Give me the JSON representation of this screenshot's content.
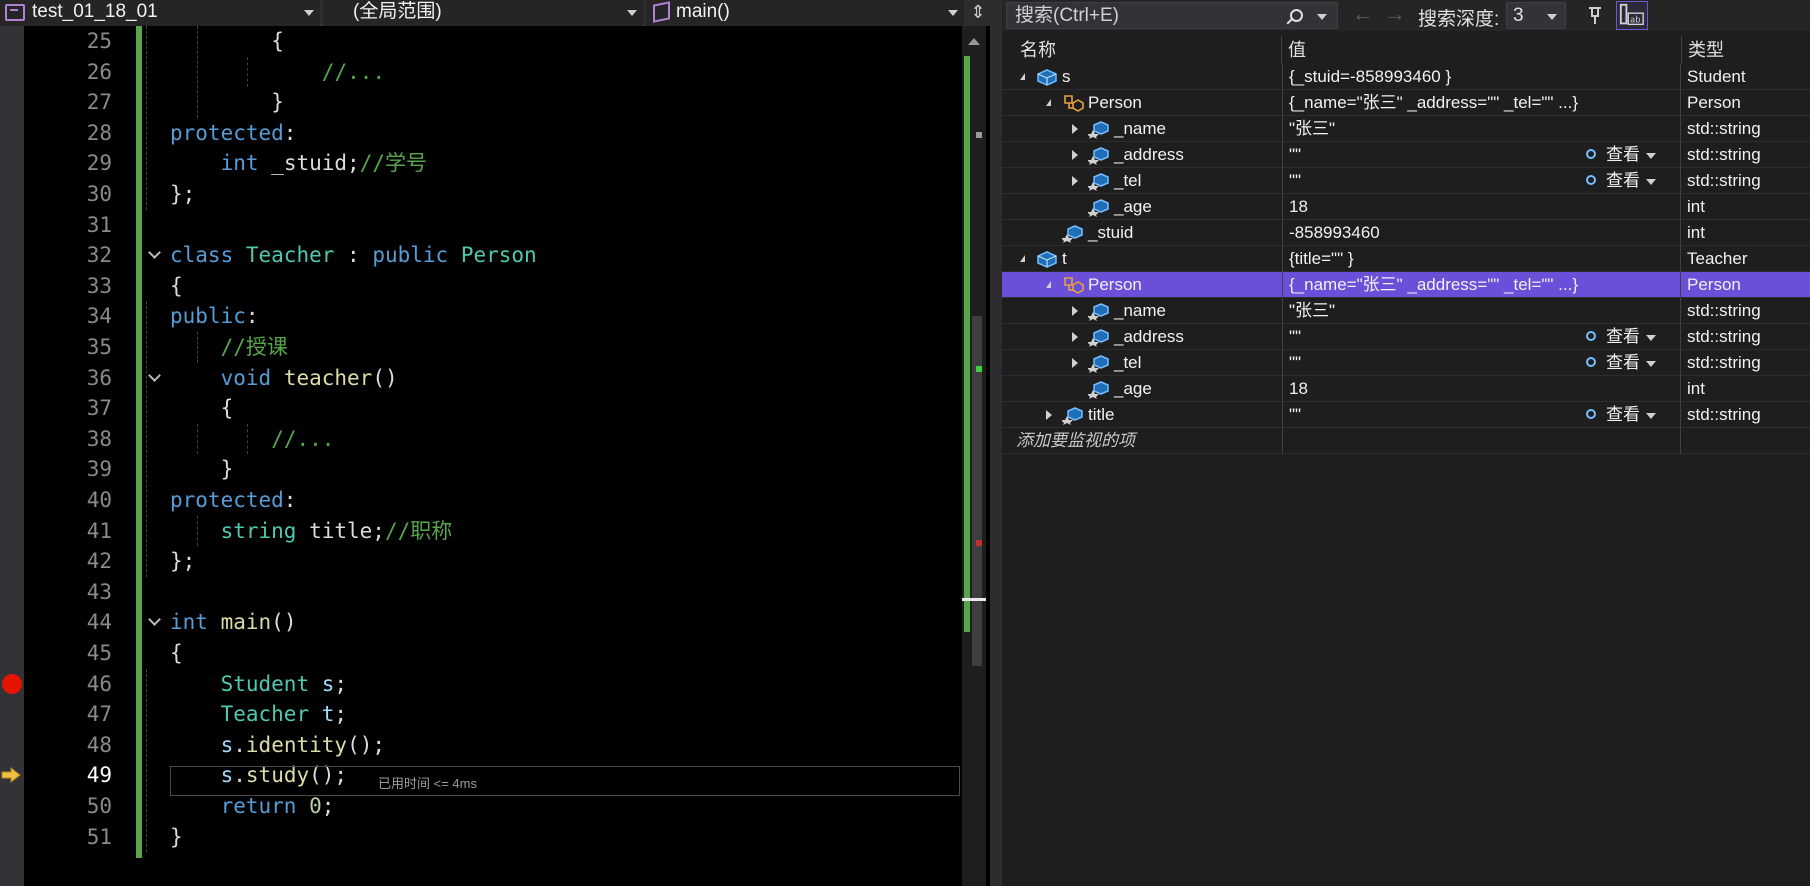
{
  "editor": {
    "nav": {
      "file": "test_01_18_01",
      "scope": "(全局范围)",
      "member": "main()"
    },
    "current_line": 49,
    "elapsed_hint": "已用时间 <= 4ms",
    "lines": [
      {
        "n": "25",
        "indent": 2,
        "tokens": [
          [
            "{",
            "p"
          ]
        ]
      },
      {
        "n": "26",
        "indent": 3,
        "tokens": [
          [
            "//...",
            "cm"
          ]
        ]
      },
      {
        "n": "27",
        "indent": 2,
        "tokens": [
          [
            "}",
            "p"
          ]
        ]
      },
      {
        "n": "28",
        "indent": 0,
        "tokens": [
          [
            "protected",
            "kw"
          ],
          [
            ":",
            "p"
          ]
        ]
      },
      {
        "n": "29",
        "indent": 1,
        "tokens": [
          [
            "int",
            "kw"
          ],
          [
            " _stuid;",
            "p"
          ],
          [
            "//学号",
            "cm"
          ]
        ]
      },
      {
        "n": "30",
        "indent": 0,
        "tokens": [
          [
            "};",
            "p"
          ]
        ]
      },
      {
        "n": "31",
        "indent": 0,
        "tokens": []
      },
      {
        "n": "32",
        "indent": 0,
        "fold": true,
        "tokens": [
          [
            "class",
            "kw"
          ],
          [
            " ",
            "p"
          ],
          [
            "Teacher",
            "ty"
          ],
          [
            " : ",
            "p"
          ],
          [
            "public",
            "kw"
          ],
          [
            " ",
            "p"
          ],
          [
            "Person",
            "ty"
          ]
        ]
      },
      {
        "n": "33",
        "indent": 0,
        "tokens": [
          [
            "{",
            "p"
          ]
        ]
      },
      {
        "n": "34",
        "indent": 0,
        "tokens": [
          [
            "public",
            "kw"
          ],
          [
            ":",
            "p"
          ]
        ]
      },
      {
        "n": "35",
        "indent": 1,
        "tokens": [
          [
            "//授课",
            "cm"
          ]
        ]
      },
      {
        "n": "36",
        "indent": 1,
        "fold": true,
        "tokens": [
          [
            "void",
            "kw"
          ],
          [
            " ",
            "p"
          ],
          [
            "teacher",
            "fn"
          ],
          [
            "()",
            "p"
          ]
        ]
      },
      {
        "n": "37",
        "indent": 1,
        "tokens": [
          [
            "{",
            "p"
          ]
        ]
      },
      {
        "n": "38",
        "indent": 2,
        "tokens": [
          [
            "//...",
            "cm"
          ]
        ]
      },
      {
        "n": "39",
        "indent": 1,
        "tokens": [
          [
            "}",
            "p"
          ]
        ]
      },
      {
        "n": "40",
        "indent": 0,
        "tokens": [
          [
            "protected",
            "kw"
          ],
          [
            ":",
            "p"
          ]
        ]
      },
      {
        "n": "41",
        "indent": 1,
        "tokens": [
          [
            "string",
            "ty"
          ],
          [
            " title;",
            "p"
          ],
          [
            "//职称",
            "cm"
          ]
        ]
      },
      {
        "n": "42",
        "indent": 0,
        "tokens": [
          [
            "};",
            "p"
          ]
        ]
      },
      {
        "n": "43",
        "indent": 0,
        "tokens": []
      },
      {
        "n": "44",
        "indent": 0,
        "fold": true,
        "tokens": [
          [
            "int",
            "kw"
          ],
          [
            " ",
            "p"
          ],
          [
            "main",
            "fn"
          ],
          [
            "()",
            "p"
          ]
        ]
      },
      {
        "n": "45",
        "indent": 0,
        "tokens": [
          [
            "{",
            "p"
          ]
        ]
      },
      {
        "n": "46",
        "indent": 1,
        "tokens": [
          [
            "Student",
            "ty"
          ],
          [
            " ",
            "p"
          ],
          [
            "s",
            "id"
          ],
          [
            ";",
            "p"
          ]
        ]
      },
      {
        "n": "47",
        "indent": 1,
        "tokens": [
          [
            "Teacher",
            "ty"
          ],
          [
            " ",
            "p"
          ],
          [
            "t",
            "id"
          ],
          [
            ";",
            "p"
          ]
        ]
      },
      {
        "n": "48",
        "indent": 1,
        "tokens": [
          [
            "s",
            "id"
          ],
          [
            ".",
            "p"
          ],
          [
            "identity",
            "fn"
          ],
          [
            "();",
            "p"
          ]
        ]
      },
      {
        "n": "49",
        "indent": 1,
        "tokens": [
          [
            "s",
            "id"
          ],
          [
            ".",
            "p"
          ],
          [
            "study",
            "fn"
          ],
          [
            "();",
            "p"
          ]
        ]
      },
      {
        "n": "50",
        "indent": 1,
        "tokens": [
          [
            "return",
            "kw"
          ],
          [
            " ",
            "p"
          ],
          [
            "0",
            "num"
          ],
          [
            ";",
            "p"
          ]
        ]
      },
      {
        "n": "51",
        "indent": 0,
        "tokens": [
          [
            "}",
            "p"
          ]
        ]
      }
    ]
  },
  "watch": {
    "search_placeholder": "搜索(Ctrl+E)",
    "depth_label": "搜索深度:",
    "depth_value": "3",
    "columns": {
      "name": "名称",
      "value": "值",
      "type": "类型"
    },
    "view_label": "查看",
    "add_item": "添加要监视的项",
    "rows": [
      {
        "level": 0,
        "exp": "open",
        "icon": "var",
        "name": "s",
        "value": "{_stuid=-858993460 }",
        "type": "Student"
      },
      {
        "level": 1,
        "exp": "open",
        "icon": "base",
        "name": "Person",
        "value": "{_name=\"张三\" _address=\"\" _tel=\"\" ...}",
        "type": "Person"
      },
      {
        "level": 2,
        "exp": "closed",
        "icon": "field",
        "name": "_name",
        "value": "\"张三\"",
        "type": "std::string"
      },
      {
        "level": 2,
        "exp": "closed",
        "icon": "field",
        "name": "_address",
        "value": "\"\"",
        "type": "std::string",
        "view": true
      },
      {
        "level": 2,
        "exp": "closed",
        "icon": "field",
        "name": "_tel",
        "value": "\"\"",
        "type": "std::string",
        "view": true
      },
      {
        "level": 2,
        "exp": "none",
        "icon": "field",
        "name": "_age",
        "value": "18",
        "type": "int"
      },
      {
        "level": 1,
        "exp": "none",
        "icon": "field",
        "name": "_stuid",
        "value": "-858993460",
        "type": "int"
      },
      {
        "level": 0,
        "exp": "open",
        "icon": "var",
        "name": "t",
        "value": "{title=\"\" }",
        "type": "Teacher"
      },
      {
        "level": 1,
        "exp": "open",
        "icon": "base",
        "name": "Person",
        "value": "{_name=\"张三\" _address=\"\" _tel=\"\" ...}",
        "type": "Person",
        "selected": true
      },
      {
        "level": 2,
        "exp": "closed",
        "icon": "field",
        "name": "_name",
        "value": "\"张三\"",
        "type": "std::string"
      },
      {
        "level": 2,
        "exp": "closed",
        "icon": "field",
        "name": "_address",
        "value": "\"\"",
        "type": "std::string",
        "view": true
      },
      {
        "level": 2,
        "exp": "closed",
        "icon": "field",
        "name": "_tel",
        "value": "\"\"",
        "type": "std::string",
        "view": true
      },
      {
        "level": 2,
        "exp": "none",
        "icon": "field",
        "name": "_age",
        "value": "18",
        "type": "int"
      },
      {
        "level": 1,
        "exp": "closed",
        "icon": "field",
        "name": "title",
        "value": "\"\"",
        "type": "std::string",
        "view": true
      }
    ]
  },
  "colors": {
    "keyword": "#569cd6",
    "type": "#4ec9b0",
    "function": "#dcdcaa",
    "comment": "#57a64a",
    "selection": "#6b4fd8",
    "breakpoint": "#e51400",
    "exec_arrow": "#f0c040"
  }
}
